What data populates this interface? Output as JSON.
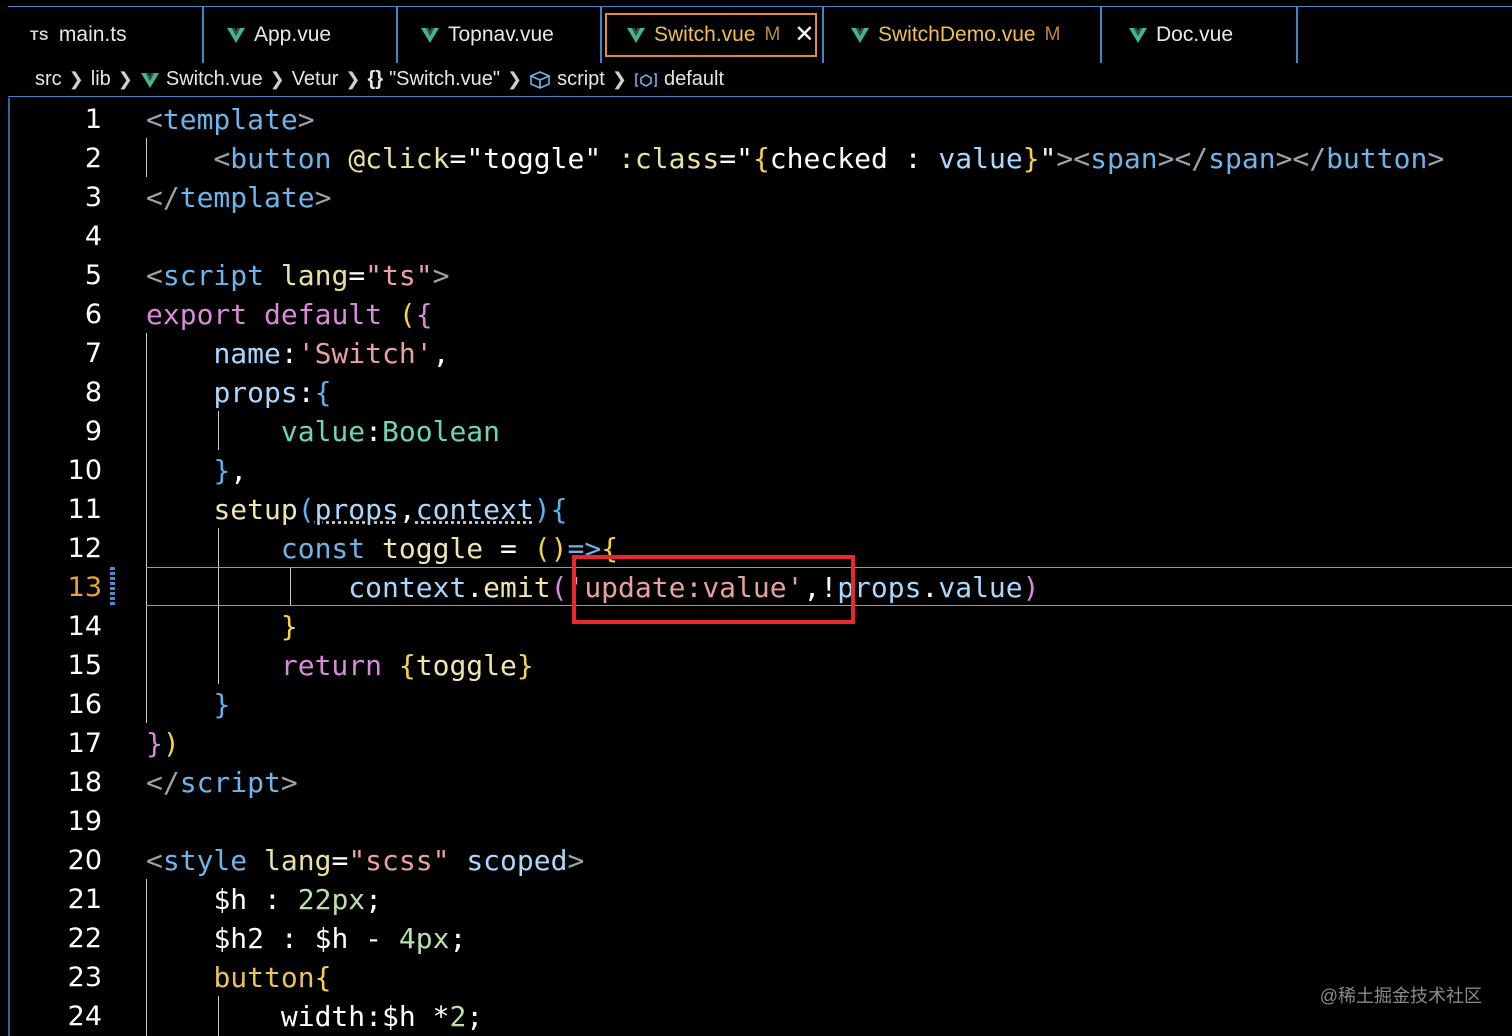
{
  "tabs": [
    {
      "label": "main.ts",
      "badge": "TS",
      "icon": "typescript-icon"
    },
    {
      "label": "App.vue",
      "icon": "vue-icon"
    },
    {
      "label": "Topnav.vue",
      "icon": "vue-icon"
    },
    {
      "label": "Switch.vue",
      "icon": "vue-icon",
      "modified": "M",
      "close": "✕",
      "active": true
    },
    {
      "label": "SwitchDemo.vue",
      "icon": "vue-icon",
      "modified": "M"
    },
    {
      "label": "Doc.vue",
      "icon": "vue-icon"
    }
  ],
  "breadcrumb": {
    "items": [
      "src",
      "lib",
      "Switch.vue",
      "Vetur",
      "\"Switch.vue\"",
      "script",
      "default"
    ],
    "braces_icon": "{}"
  },
  "editor": {
    "current_line": 13,
    "line_numbers": [
      "1",
      "2",
      "3",
      "4",
      "5",
      "6",
      "7",
      "8",
      "9",
      "10",
      "11",
      "12",
      "13",
      "14",
      "15",
      "16",
      "17",
      "18",
      "19",
      "20",
      "21",
      "22",
      "23",
      "24"
    ]
  },
  "watermark": "@稀土掘金技术社区",
  "colors": {
    "accent_blue": "#3a88c9",
    "active_tab_border": "#e08a3c",
    "highlight_box": "#e8282c",
    "vue_green": "#41b883"
  }
}
